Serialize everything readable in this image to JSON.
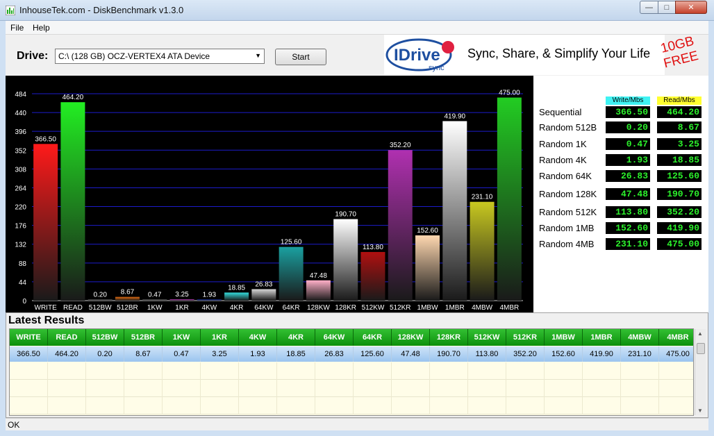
{
  "window": {
    "title": "InhouseTek.com - DiskBenchmark v1.3.0"
  },
  "menu": {
    "file": "File",
    "help": "Help"
  },
  "drive": {
    "label": "Drive:",
    "selected": "C:\\ (128 GB) OCZ-VERTEX4 ATA Device"
  },
  "start_label": "Start",
  "ad": {
    "brand": "IDrive",
    "sub": "sync",
    "slogan": "Sync, Share, & Simplify Your Life",
    "free_line1": "10GB",
    "free_line2": "FREE"
  },
  "chart_data": {
    "type": "bar",
    "categories": [
      "WRITE",
      "READ",
      "512BW",
      "512BR",
      "1KW",
      "1KR",
      "4KW",
      "4KR",
      "64KW",
      "64KR",
      "128KW",
      "128KR",
      "512KW",
      "512KR",
      "1MBW",
      "1MBR",
      "4MBW",
      "4MBR"
    ],
    "values": [
      366.5,
      464.2,
      0.2,
      8.67,
      0.47,
      3.25,
      1.93,
      18.85,
      26.83,
      125.6,
      47.48,
      190.7,
      113.8,
      352.2,
      152.6,
      419.9,
      231.1,
      475.0
    ],
    "value_labels": [
      "366.50",
      "464.20",
      "0.20",
      "8.67",
      "0.47",
      "3.25",
      "1.93",
      "18.85",
      "26.83",
      "125.60",
      "47.48",
      "190.70",
      "113.80",
      "352.20",
      "152.60",
      "419.90",
      "231.10",
      "475.00"
    ],
    "colors": [
      "#ff1a1a",
      "#22ee22",
      "#9a9a9a",
      "#e06a10",
      "#a0a0a0",
      "#c040c0",
      "#3355ff",
      "#33dddd",
      "#d8d8d8",
      "#1aa0a0",
      "#ffb0c8",
      "#ffffff",
      "#b01010",
      "#b030b0",
      "#ffd8b0",
      "#ffffff",
      "#c8c820",
      "#22cc22"
    ],
    "yticks": [
      0,
      44,
      88,
      132,
      176,
      220,
      264,
      308,
      352,
      396,
      440,
      484
    ],
    "ylim": [
      0,
      484
    ],
    "grid": true
  },
  "side": {
    "write_header": "Write/Mbs",
    "read_header": "Read/Mbs",
    "rows": [
      {
        "label": "Sequential",
        "write": "366.50",
        "read": "464.20"
      },
      {
        "label": "Random 512B",
        "write": "0.20",
        "read": "8.67"
      },
      {
        "label": "Random 1K",
        "write": "0.47",
        "read": "3.25"
      },
      {
        "label": "Random 4K",
        "write": "1.93",
        "read": "18.85"
      },
      {
        "label": "Random 64K",
        "write": "26.83",
        "read": "125.60"
      },
      {
        "label": "Random 128K",
        "write": "47.48",
        "read": "190.70"
      },
      {
        "label": "Random 512K",
        "write": "113.80",
        "read": "352.20"
      },
      {
        "label": "Random 1MB",
        "write": "152.60",
        "read": "419.90"
      },
      {
        "label": "Random 4MB",
        "write": "231.10",
        "read": "475.00"
      }
    ]
  },
  "latest": {
    "title": "Latest Results",
    "columns": [
      "WRITE",
      "READ",
      "512BW",
      "512BR",
      "1KW",
      "1KR",
      "4KW",
      "4KR",
      "64KW",
      "64KR",
      "128KW",
      "128KR",
      "512KW",
      "512KR",
      "1MBW",
      "1MBR",
      "4MBW",
      "4MBR"
    ],
    "rows": [
      [
        "366.50",
        "464.20",
        "0.20",
        "8.67",
        "0.47",
        "3.25",
        "1.93",
        "18.85",
        "26.83",
        "125.60",
        "47.48",
        "190.70",
        "113.80",
        "352.20",
        "152.60",
        "419.90",
        "231.10",
        "475.00"
      ]
    ]
  },
  "status": "OK",
  "colors": {
    "value_text": "#2cf22c",
    "grid_header": "#12a012",
    "chart_gridline": "#1c1ccc"
  }
}
